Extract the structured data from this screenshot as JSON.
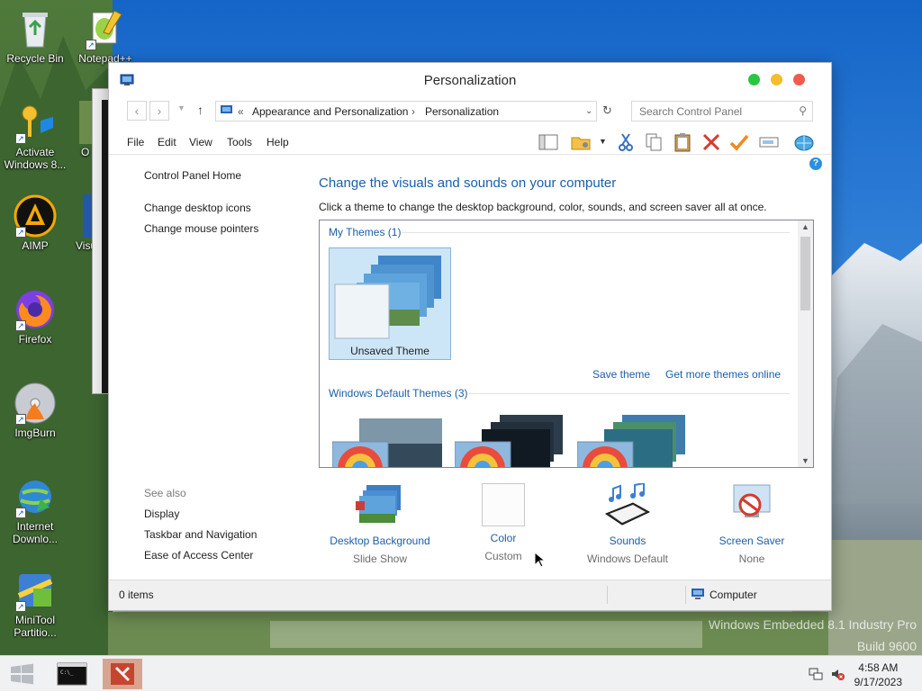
{
  "desktop": {
    "icons": [
      {
        "label": "Recycle Bin"
      },
      {
        "label": "Notepad++"
      },
      {
        "label": "Activate Windows 8..."
      },
      {
        "label": "O"
      },
      {
        "label": "AIMP"
      },
      {
        "label": "Visu"
      },
      {
        "label": "Firefox"
      },
      {
        "label": "ImgBurn"
      },
      {
        "label": "Internet Downlo..."
      },
      {
        "label": "MiniTool Partitio..."
      }
    ],
    "watermark_line1": "Windows Embedded 8.1 Industry Pro",
    "watermark_line2": "Build 9600"
  },
  "window": {
    "title": "Personalization",
    "address": {
      "chevrons": "«",
      "crumb1": "Appearance and Personalization",
      "separator": "›",
      "crumb2": "Personalization"
    },
    "search": {
      "placeholder": "Search Control Panel"
    },
    "menu": [
      "File",
      "Edit",
      "View",
      "Tools",
      "Help"
    ],
    "leftnav": {
      "home": "Control Panel Home",
      "items": [
        "Change desktop icons",
        "Change mouse pointers"
      ],
      "see_also_heading": "See also",
      "see_also": [
        "Display",
        "Taskbar and Navigation",
        "Ease of Access Center"
      ]
    },
    "main": {
      "heading": "Change the visuals and sounds on your computer",
      "subheading": "Click a theme to change the desktop background, color, sounds, and screen saver all at once.",
      "my_themes_label": "My Themes (1)",
      "unsaved_theme": "Unsaved Theme",
      "save_theme": "Save theme",
      "get_more": "Get more themes online",
      "default_themes_label": "Windows Default Themes (3)"
    },
    "bottom": [
      {
        "label": "Desktop Background",
        "sub": "Slide Show"
      },
      {
        "label": "Color",
        "sub": "Custom"
      },
      {
        "label": "Sounds",
        "sub": "Windows Default"
      },
      {
        "label": "Screen Saver",
        "sub": "None"
      }
    ],
    "status": {
      "items": "0 items",
      "location": "Computer"
    },
    "help_glyph": "?"
  },
  "taskbar": {
    "time": "4:58 AM",
    "date": "9/17/2023"
  },
  "colors": {
    "link_blue": "#1b5ea8",
    "close_red": "#f05a4f",
    "min_yellow": "#f5bd2e",
    "max_green": "#2ac640"
  }
}
